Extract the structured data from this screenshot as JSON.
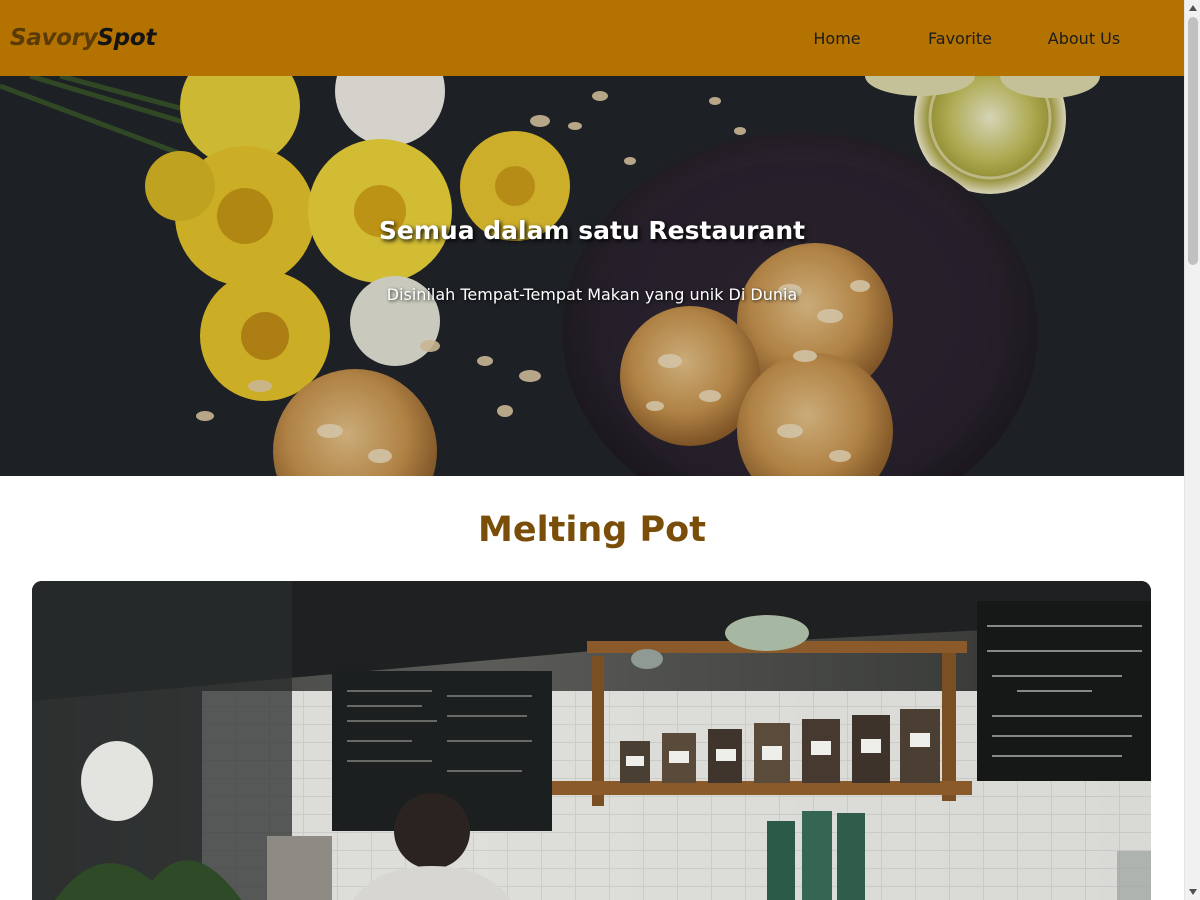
{
  "header": {
    "brand_part1": "Savory",
    "brand_part2": "Spot",
    "nav": [
      {
        "label": "Home"
      },
      {
        "label": "Favorite"
      },
      {
        "label": "About Us"
      }
    ]
  },
  "hero": {
    "title": "Semua dalam satu Restaurant",
    "subtitle": "Disinilah Tempat-Tempat Makan yang unik Di Dunia"
  },
  "main": {
    "restaurant_name": "Melting Pot"
  },
  "colors": {
    "header_bg": "#b47200",
    "title_color": "#7a4d08"
  }
}
